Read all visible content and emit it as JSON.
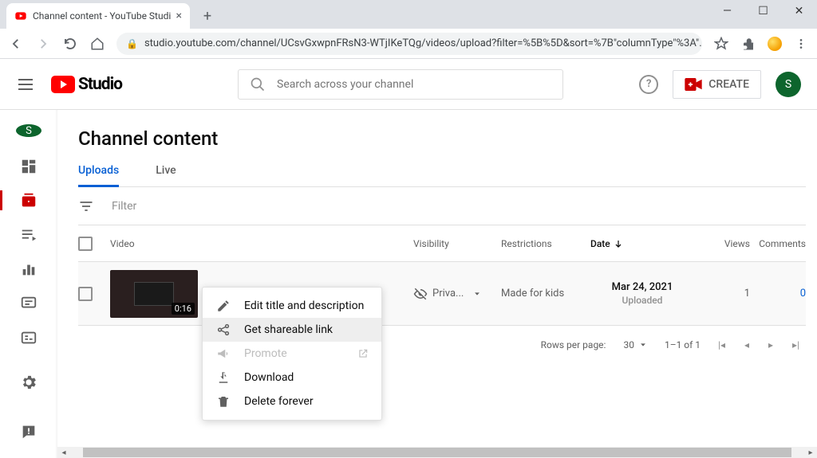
{
  "browser": {
    "tab_title": "Channel content - YouTube Studi",
    "url": "studio.youtube.com/channel/UCsvGxwpnFRsN3-WTjIKeTQg/videos/upload?filter=%5B%5D&sort=%7B\"columnType\"%3A\"..."
  },
  "header": {
    "logo_text": "Studio",
    "search_placeholder": "Search across your channel",
    "create_label": "CREATE",
    "avatar_initial": "S"
  },
  "sidebar": {
    "avatar_initial": "S"
  },
  "page": {
    "title": "Channel content",
    "tabs": {
      "uploads": "Uploads",
      "live": "Live"
    },
    "filter_placeholder": "Filter"
  },
  "table": {
    "headers": {
      "video": "Video",
      "visibility": "Visibility",
      "restrictions": "Restrictions",
      "date": "Date",
      "views": "Views",
      "comments": "Comments"
    },
    "row": {
      "duration": "0:16",
      "visibility": "Priva...",
      "restrictions": "Made for kids",
      "date": "Mar 24, 2021",
      "date_sub": "Uploaded",
      "views": "1",
      "comments": "0"
    }
  },
  "pager": {
    "rows_label": "Rows per page:",
    "rows_value": "30",
    "range": "1–1 of 1"
  },
  "context_menu": {
    "edit": "Edit title and description",
    "share": "Get shareable link",
    "promote": "Promote",
    "download": "Download",
    "delete": "Delete forever"
  }
}
